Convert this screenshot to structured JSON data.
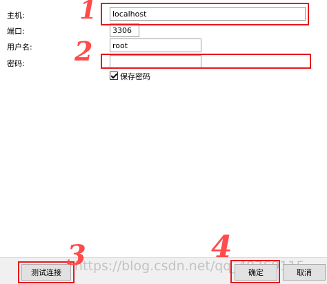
{
  "form": {
    "host_label": "主机:",
    "host_value": "localhost",
    "port_label": "端口:",
    "port_value": "3306",
    "user_label": "用户名:",
    "user_value": "root",
    "password_label": "密码:",
    "password_value": "",
    "save_password_label": "保存密码",
    "save_password_checked": true
  },
  "buttons": {
    "test_connection": "测试连接",
    "ok": "确定",
    "cancel": "取消"
  },
  "annotations": {
    "step1": "1",
    "step2": "2",
    "step3": "3",
    "step4": "4",
    "highlight_color": "#e8151b",
    "number_color": "#ff4b4b"
  },
  "watermark": "https://blog.csdn.net/qq_40769115"
}
